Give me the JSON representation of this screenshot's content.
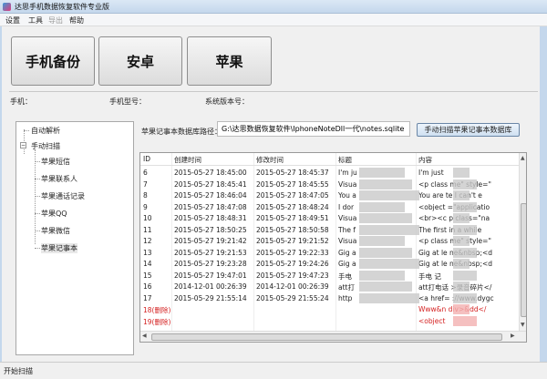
{
  "window": {
    "title": "达思手机数据恢复软件专业版"
  },
  "menu": [
    "设置",
    "工具",
    "导出",
    "帮助"
  ],
  "big_buttons": [
    "手机备份",
    "安卓",
    "苹果"
  ],
  "info": {
    "phone": "手机：",
    "model": "手机型号：",
    "os_version": "系统版本号："
  },
  "tree": {
    "auto": "自动解析",
    "manual": "手动扫描",
    "children": [
      "苹果短信",
      "苹果联系人",
      "苹果通话记录",
      "苹果QQ",
      "苹果微信",
      "苹果记事本"
    ]
  },
  "path": {
    "label": "苹果记事本数据库路径：",
    "value": "G:\\达思数据恢复软件\\IphoneNoteDll一代\\notes.sqlite",
    "scan_button": "手动扫描苹果记事本数据库"
  },
  "table": {
    "headers": [
      "ID",
      "创建时间",
      "修改时间",
      "标题",
      "内容"
    ],
    "rows": [
      [
        "6",
        "2015-05-27  18:45:00",
        "2015-05-27  18:45:37",
        "I'm ju",
        "I'm just"
      ],
      [
        "7",
        "2015-05-27  18:45:41",
        "2015-05-27  18:45:55",
        "Visua",
        "<p class  me\" style=\""
      ],
      [
        "8",
        "2015-05-27  18:46:04",
        "2015-05-27  18:47:05",
        "You a",
        "You are   te I can't e"
      ],
      [
        "9",
        "2015-05-27  18:47:08",
        "2015-05-27  18:48:24",
        "I dor",
        "<object   =\"applicatio"
      ],
      [
        "10",
        "2015-05-27  18:48:31",
        "2015-05-27  18:49:51",
        "Visua",
        "<br><c   p class=\"na"
      ],
      [
        "11",
        "2015-05-27  18:50:25",
        "2015-05-27  18:50:58",
        "The f",
        "The first   in a while"
      ],
      [
        "12",
        "2015-05-27  19:21:42",
        "2015-05-27  19:21:52",
        "Visua",
        "<p class   me\" style=\""
      ],
      [
        "13",
        "2015-05-27  19:21:53",
        "2015-05-27  19:22:33",
        "Gig a",
        "Gig at le   ne&nbsp;<d"
      ],
      [
        "14",
        "2015-05-27  19:23:28",
        "2015-05-27  19:24:26",
        "Gig a",
        "Gig at le   ne&nbsp;<d"
      ],
      [
        "15",
        "2015-05-27  19:47:01",
        "2015-05-27  19:47:23",
        "手电",
        "手电 记"
      ],
      [
        "16",
        "2014-12-01  00:26:39",
        "2014-12-01  00:26:39",
        "att打",
        "att打电话   >录音碎片</"
      ],
      [
        "17",
        "2015-05-29  21:55:14",
        "2015-05-29  21:55:24",
        "http",
        "<a href=   ://www.dygc"
      ],
      [
        "18(删除)",
        "",
        "",
        "",
        "Www&n   div>&dd</"
      ],
      [
        "19(删除)",
        "",
        "",
        "",
        "<object"
      ]
    ],
    "deleted_color": "#d42020"
  },
  "status": "开始扫描"
}
